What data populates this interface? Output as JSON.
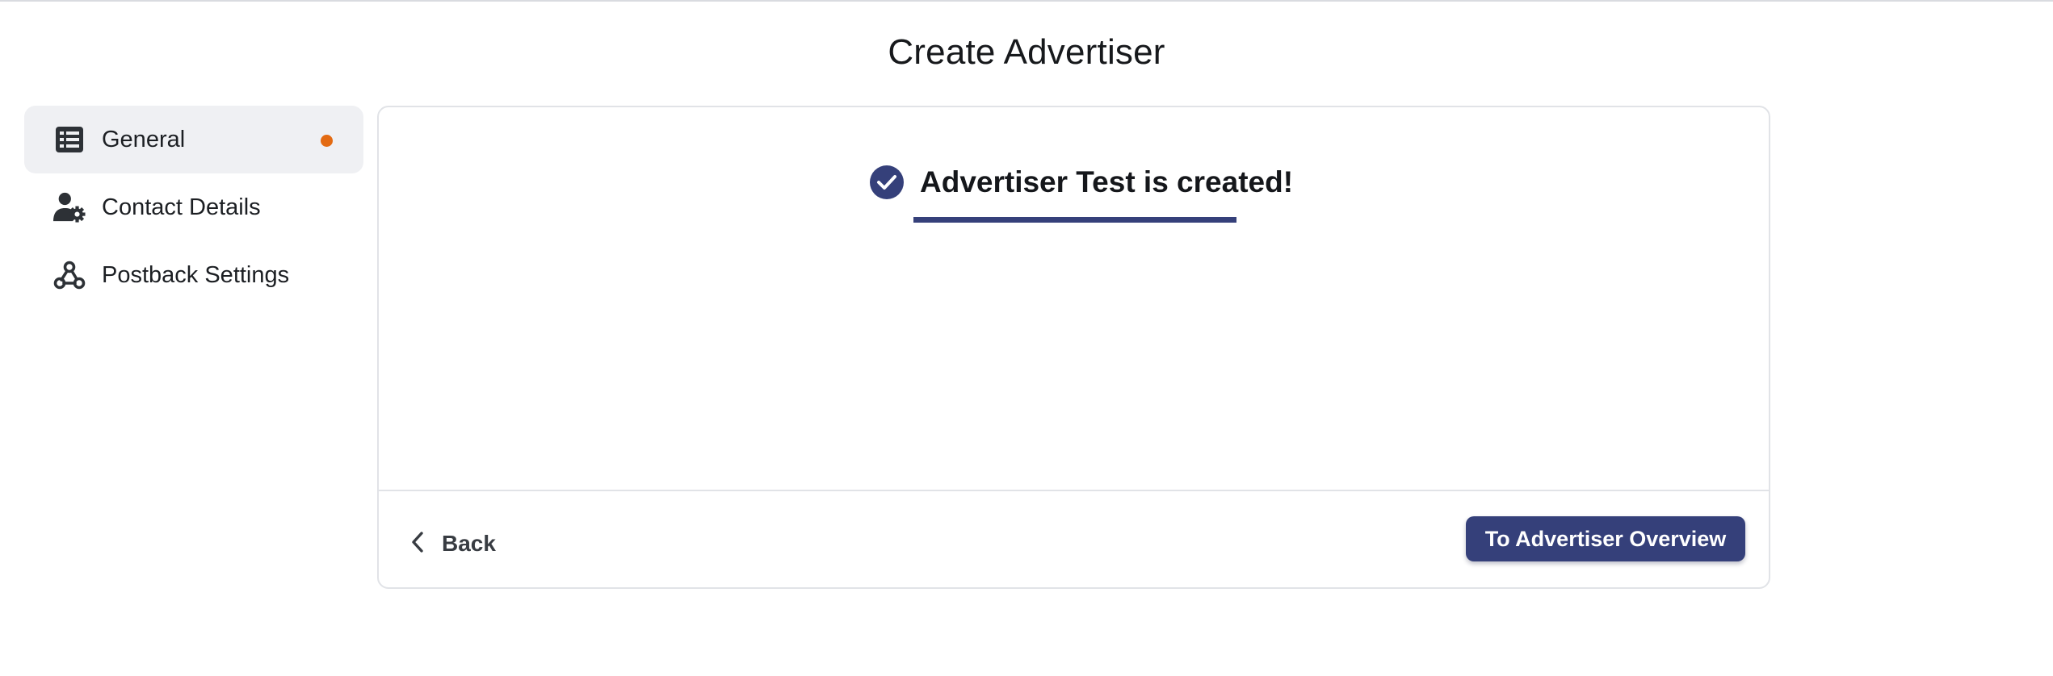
{
  "page": {
    "title": "Create Advertiser"
  },
  "sidebar": {
    "items": [
      {
        "label": "General",
        "icon": "list-icon",
        "active": true,
        "indicator": "unsaved-dot"
      },
      {
        "label": "Contact Details",
        "icon": "user-gear-icon",
        "active": false
      },
      {
        "label": "Postback Settings",
        "icon": "webhook-icon",
        "active": false
      }
    ]
  },
  "main": {
    "success_message": "Advertiser Test is created!",
    "success_icon": "check-circle-icon",
    "back_label": "Back",
    "back_icon": "chevron-left-icon",
    "primary_button_label": "To Advertiser Overview"
  },
  "colors": {
    "accent": "#35407a",
    "indicator": "#e36a12",
    "active_bg": "#eff0f3",
    "border": "#e1e3e7"
  }
}
